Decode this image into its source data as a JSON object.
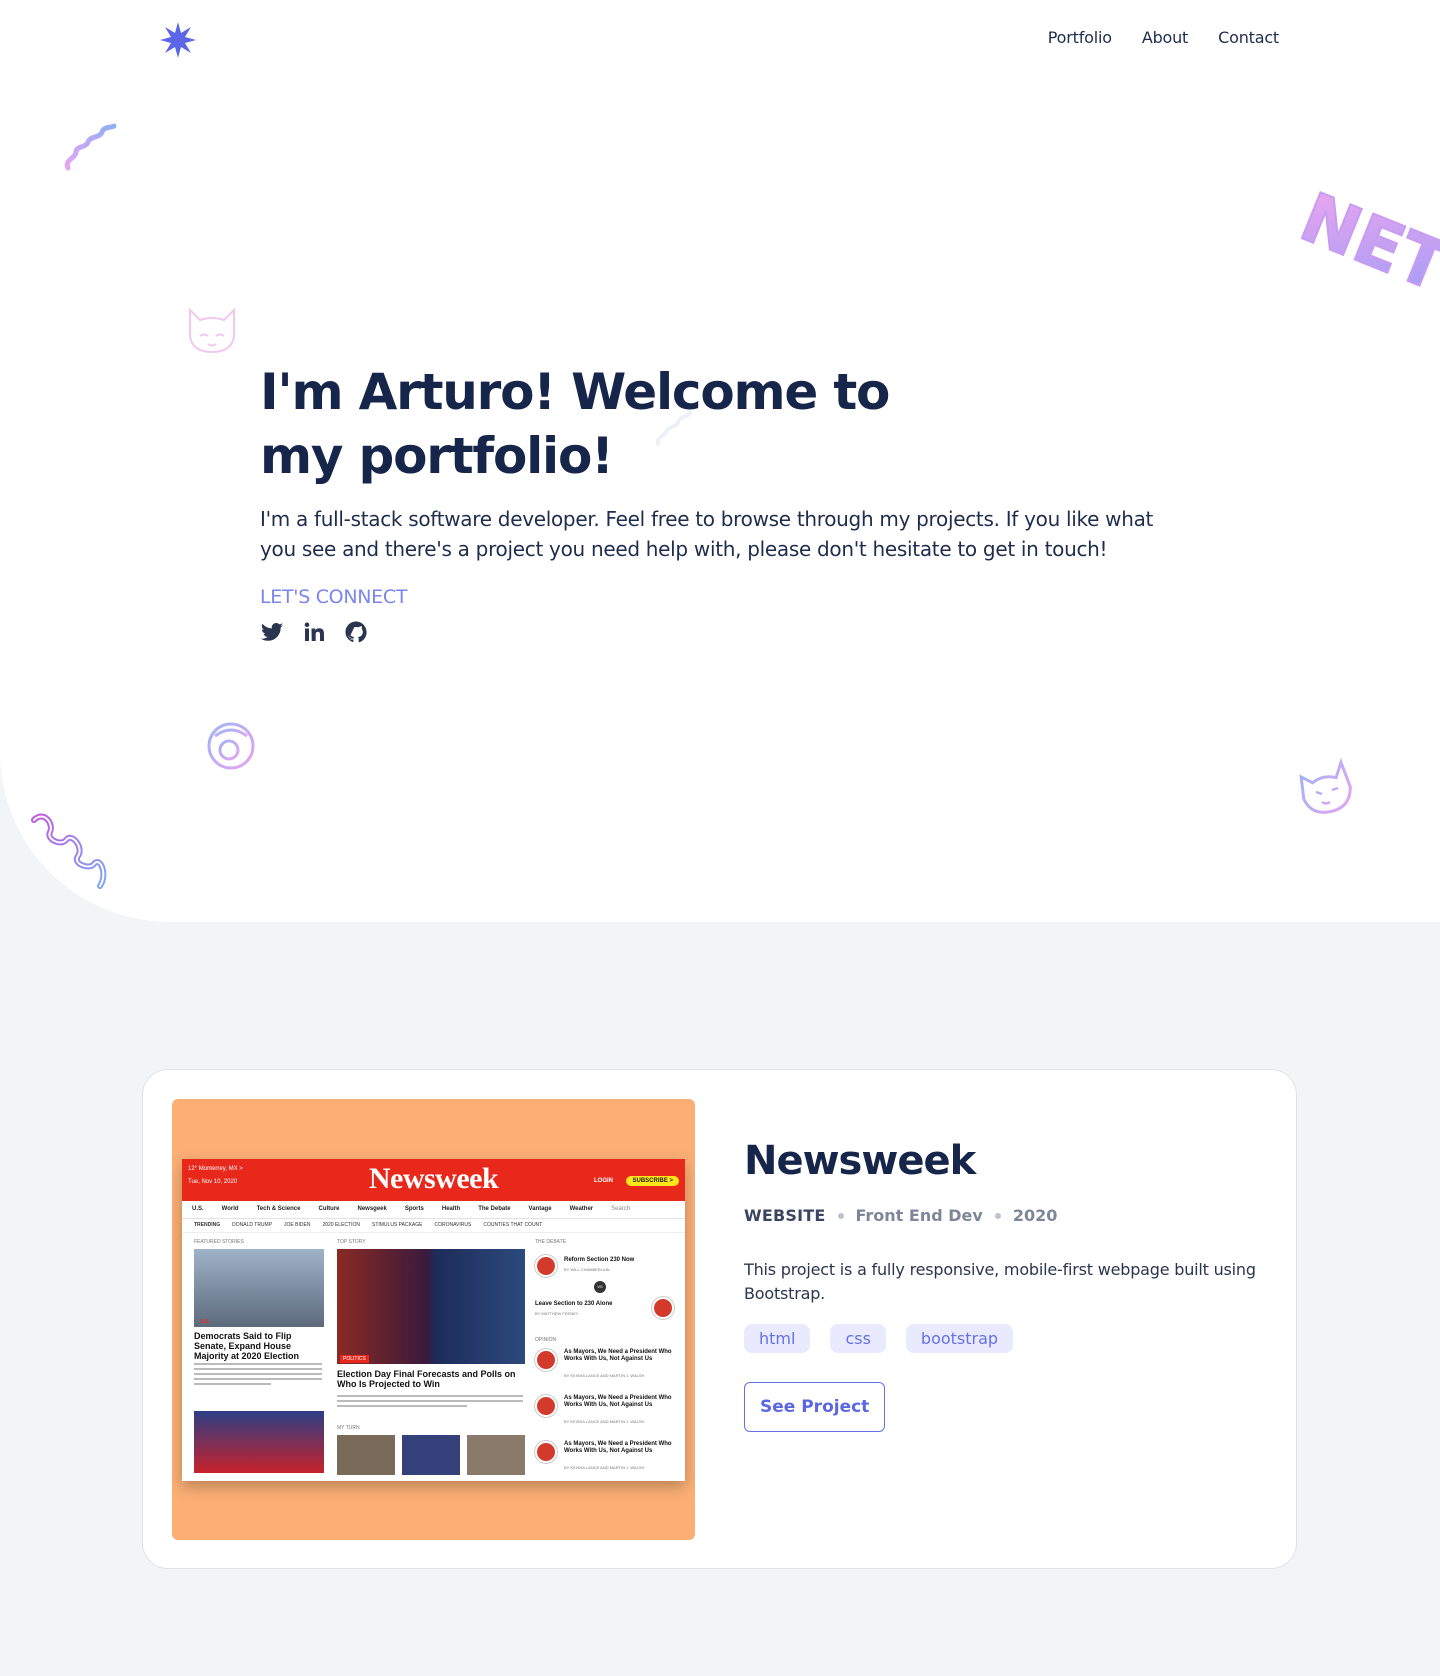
{
  "nav": {
    "items": [
      "Portfolio",
      "About",
      "Contact"
    ]
  },
  "hero": {
    "title": "I'm Arturo! Welcome to my portfolio!",
    "subtitle": "I'm a full-stack software developer. Feel free to browse through my projects. If you like what you see and there's a project you need help with, please don't hesitate to get in touch!",
    "connect_label": "LET'S CONNECT",
    "socials": [
      "twitter-icon",
      "linkedin-icon",
      "github-icon"
    ],
    "deco_text": "NET"
  },
  "project": {
    "title": "Newsweek",
    "type": "WEBSITE",
    "role": "Front End Dev",
    "year": "2020",
    "description": "This project is a fully responsive, mobile-first webpage built using Bootstrap.",
    "tags": [
      "html",
      "css",
      "bootstrap"
    ],
    "button_label": "See Project",
    "thumbnail": {
      "logo": "Newsweek",
      "location": "12° Monterrey, MX >",
      "date": "Tue, Nov 10, 2020",
      "login": "LOGIN",
      "subscribe": "SUBSCRIBE >",
      "menu": [
        "U.S.",
        "World",
        "Tech & Science",
        "Culture",
        "Newsgeek",
        "Sports",
        "Health",
        "The Debate",
        "Vantage",
        "Weather"
      ],
      "search_placeholder": "Search",
      "trending": [
        "TRENDING",
        "DONALD TRUMP",
        "JOE BIDEN",
        "2020 ELECTION",
        "STIMULUS PACKAGE",
        "CORONAVIRUS",
        "COUNTIES THAT COUNT"
      ],
      "featured_label": "FEATURED STORIES",
      "top_story_label": "TOP STORY",
      "debate_label": "THE DEBATE",
      "featured_tag": "U.S.",
      "featured_headline": "Democrats Said to Flip Senate, Expand House Majority at 2020 Election",
      "politics_tag": "POLITICS",
      "top_headline": "Election Day Final Forecasts and Polls on Who Is Projected to Win",
      "my_turn_label": "MY TURN",
      "debate_1": "Reform Section 230 Now",
      "debate_1_by": "BY WILL CHAMBERLAIN",
      "vs": "VS",
      "debate_2": "Leave Section to 230 Alone",
      "debate_2_by": "BY MATTHEW FEENEY",
      "opinion_label": "OPINION",
      "opinion_headline": "As Mayors, We Need a President Who Works With Us, Not Against Us",
      "opinion_by": "BY KEISHA LANCE AND MARTIN J. WALSH"
    }
  },
  "colors": {
    "accent": "#6570e5",
    "navy": "#16254a",
    "thumb_bg": "#fbaf74",
    "newsweek_red": "#e8281b"
  }
}
